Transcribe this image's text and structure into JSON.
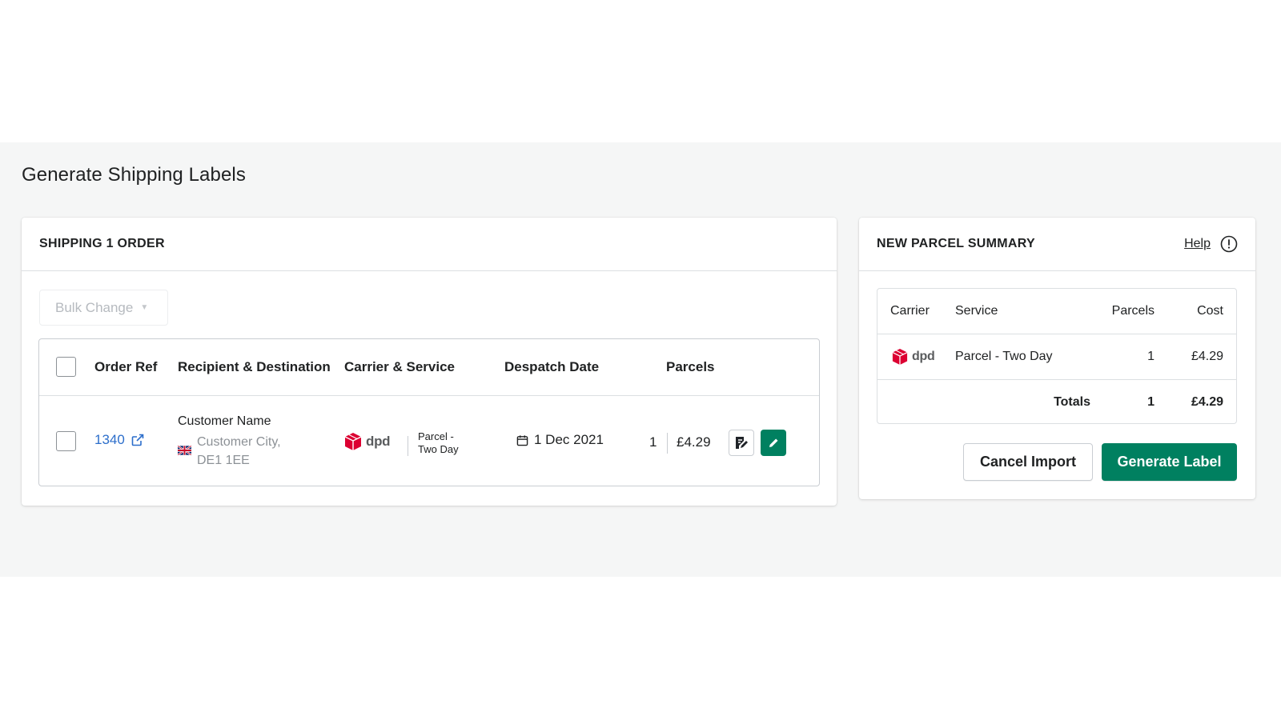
{
  "page": {
    "title": "Generate Shipping Labels"
  },
  "orders_card": {
    "title": "SHIPPING 1 ORDER",
    "bulk_change_label": "Bulk Change",
    "columns": [
      "Order Ref",
      "Recipient & Destination",
      "Carrier & Service",
      "Despatch Date",
      "Parcels"
    ],
    "rows": [
      {
        "order_ref": "1340",
        "recipient_name": "Customer Name",
        "recipient_address": "Customer City, DE1 1EE",
        "country_flag": "uk-flag-icon",
        "carrier": "dpd",
        "service": "Parcel - Two Day",
        "despatch_date": "1 Dec 2021",
        "parcels": "1",
        "cost": "£4.29"
      }
    ]
  },
  "summary_card": {
    "title": "NEW PARCEL SUMMARY",
    "help_label": "Help",
    "columns": [
      "Carrier",
      "Service",
      "Parcels",
      "Cost"
    ],
    "rows": [
      {
        "carrier": "dpd",
        "service": "Parcel - Two Day",
        "parcels": "1",
        "cost": "£4.29"
      }
    ],
    "totals": {
      "label": "Totals",
      "parcels": "1",
      "cost": "£4.29"
    },
    "cancel_label": "Cancel Import",
    "generate_label": "Generate Label"
  },
  "colors": {
    "primary_green": "#008060",
    "link_blue": "#2c6ecb",
    "dpd_red": "#dc0032",
    "background": "#f5f6f6"
  }
}
